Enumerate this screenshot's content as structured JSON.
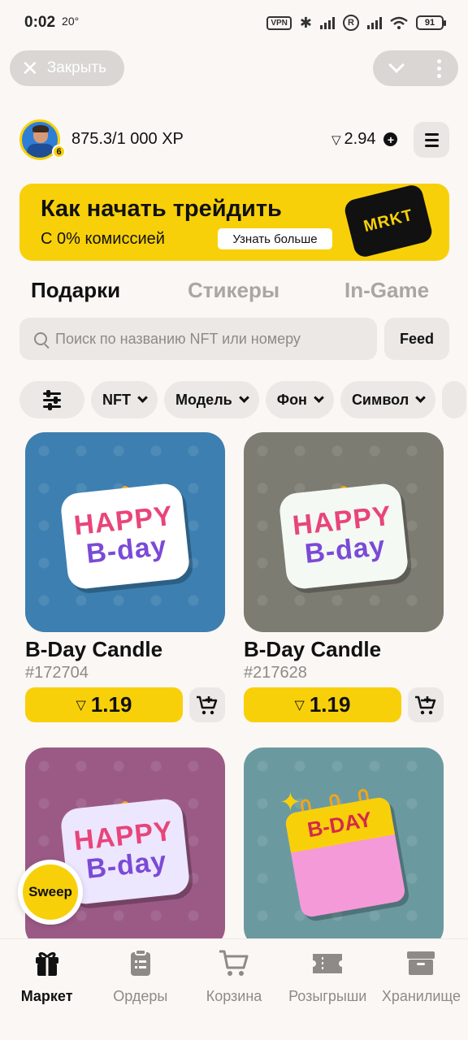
{
  "status": {
    "time": "0:02",
    "temp": "20°",
    "vpn": "VPN",
    "roaming": "R",
    "battery": "91"
  },
  "tg": {
    "close_label": "Закрыть"
  },
  "profile": {
    "level": "6",
    "xp": "875.3/1 000 XP",
    "balance": "2.94"
  },
  "banner": {
    "title": "Как начать трейдить",
    "subtitle": "С 0% комиссией",
    "button": "Узнать больше",
    "logo": "MRKT"
  },
  "tabs": [
    "Подарки",
    "Стикеры",
    "In-Game"
  ],
  "search": {
    "placeholder": "Поиск по названию NFT или номеру",
    "feed_label": "Feed"
  },
  "filters": [
    "NFT",
    "Модель",
    "Фон",
    "Символ"
  ],
  "cards": [
    {
      "name": "B-Day Candle",
      "number": "#172704",
      "price": "1.19",
      "bg": "#3d7fb0",
      "text": "HAPPY B-day"
    },
    {
      "name": "B-Day Candle",
      "number": "#217628",
      "price": "1.19",
      "bg": "#7c7c72",
      "text": "HAPPY B-day"
    },
    {
      "name": "",
      "number": "",
      "price": "",
      "bg": "#9b5a86",
      "text": "HAPPY B-day"
    },
    {
      "name": "",
      "number": "",
      "price": "",
      "bg": "#6a9aa0",
      "text": "B-DAY"
    }
  ],
  "sweep_label": "Sweep",
  "nav": [
    "Маркет",
    "Ордеры",
    "Корзина",
    "Розыгрыши",
    "Хранилище"
  ],
  "colors": {
    "accent": "#f8d00a",
    "background": "#fbf7f4",
    "muted": "#8d8a87"
  }
}
